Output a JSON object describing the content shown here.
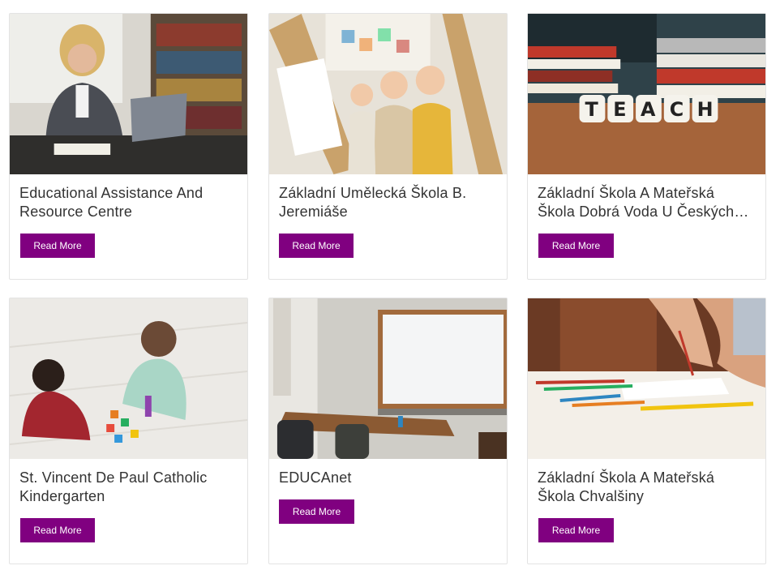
{
  "cards": [
    {
      "title": "Educational Assistance And Resource Centre",
      "button_label": "Read More",
      "image": "woman-teaching-online-laptop"
    },
    {
      "title": "Základní Umělecká Škola B. Jeremiáše",
      "button_label": "Read More",
      "image": "children-at-easels"
    },
    {
      "title": "Základní Škola A Mateřská Škola Dobrá Voda U Českých Budějovic",
      "button_label": "Read More",
      "image": "teach-letter-dice-books"
    },
    {
      "title": "St. Vincent De Paul Catholic Kindergarten",
      "button_label": "Read More",
      "image": "toddlers-playing-blocks"
    },
    {
      "title": "EDUCAnet",
      "button_label": "Read More",
      "image": "empty-classroom-whiteboard"
    },
    {
      "title": "Základní Škola A Mateřská Škola Chvalšiny",
      "button_label": "Read More",
      "image": "child-writing-colored-pencils"
    }
  ],
  "accent_color": "#800080"
}
